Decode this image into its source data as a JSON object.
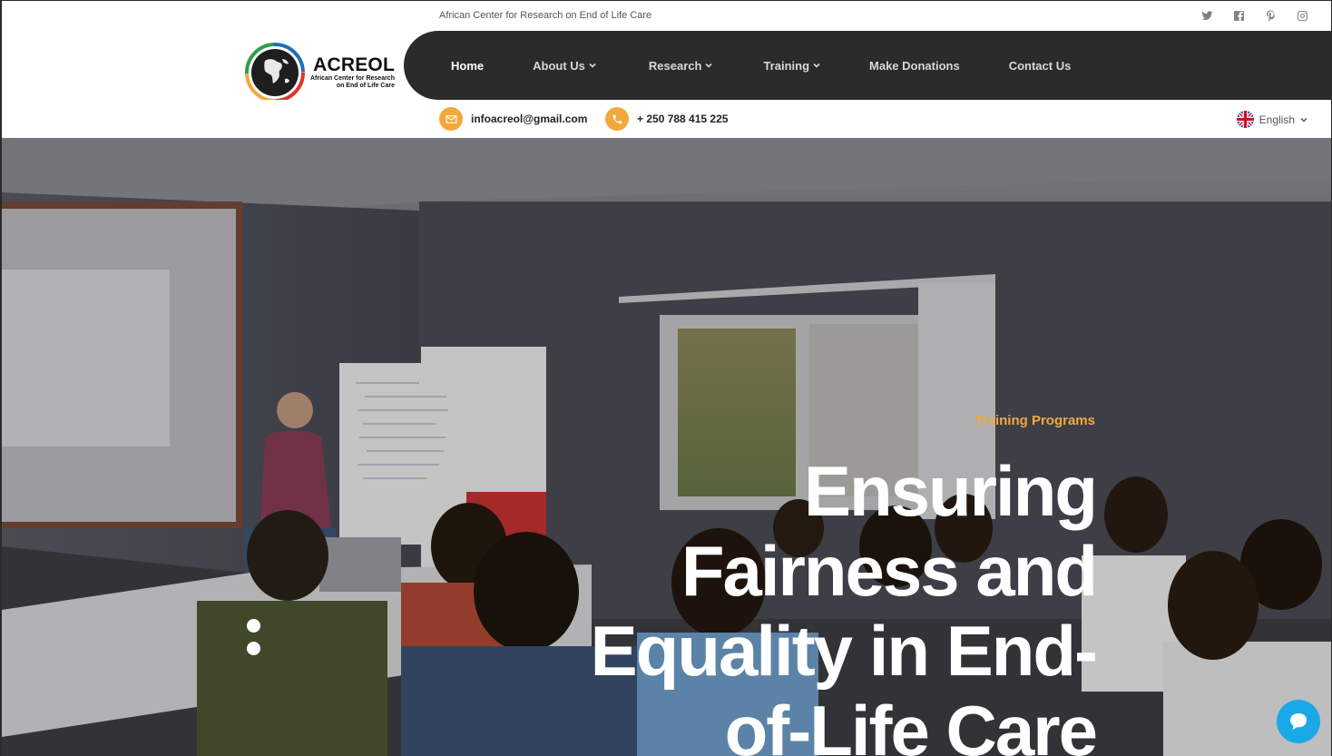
{
  "topbar": {
    "tagline": "African Center for Research on End of Life Care",
    "socials": [
      "twitter-icon",
      "facebook-icon",
      "pinterest-icon",
      "instagram-icon"
    ]
  },
  "logo": {
    "title": "ACREOL",
    "subtitle_line1": "African Center for Research",
    "subtitle_line2": "on End of Life Care"
  },
  "nav": {
    "items": [
      {
        "label": "Home",
        "active": true,
        "dropdown": false
      },
      {
        "label": "About Us",
        "active": false,
        "dropdown": true
      },
      {
        "label": "Research",
        "active": false,
        "dropdown": true
      },
      {
        "label": "Training",
        "active": false,
        "dropdown": true
      },
      {
        "label": "Make Donations",
        "active": false,
        "dropdown": false
      },
      {
        "label": "Contact Us",
        "active": false,
        "dropdown": false
      }
    ]
  },
  "contact": {
    "email": "infoacreol@gmail.com",
    "phone": "+ 250 788 415 225",
    "language": "English"
  },
  "hero": {
    "kicker": "Training Programs",
    "title": "Ensuring Fairness and Equality in End-of-Life Care"
  },
  "colors": {
    "accent": "#f2a93b",
    "nav_bg": "#2b2b2b",
    "chat": "#19a9e6"
  }
}
